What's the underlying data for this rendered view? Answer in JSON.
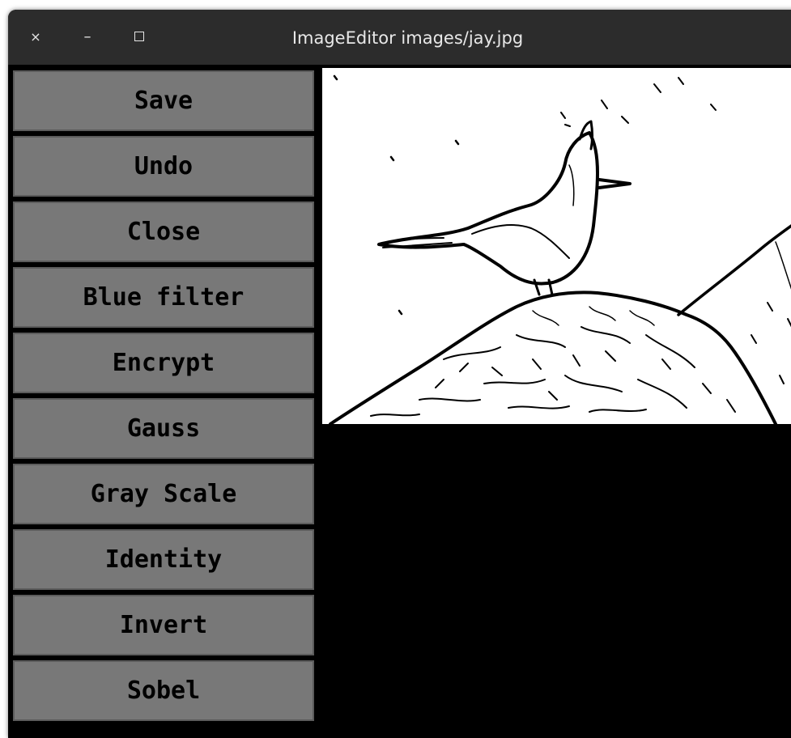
{
  "window": {
    "title": "ImageEditor images/jay.jpg",
    "controls": {
      "close": "×",
      "minimize": "–"
    }
  },
  "sidebar": {
    "buttons": [
      {
        "label": "Save"
      },
      {
        "label": "Undo"
      },
      {
        "label": "Close"
      },
      {
        "label": "Blue filter"
      },
      {
        "label": "Encrypt"
      },
      {
        "label": "Gauss"
      },
      {
        "label": "Gray Scale"
      },
      {
        "label": "Identity"
      },
      {
        "label": "Invert"
      },
      {
        "label": "Sobel"
      }
    ]
  },
  "canvas": {
    "image": "edge-detected jay bird on rock",
    "background_color": "#ffffff",
    "line_color": "#000000"
  },
  "colors": {
    "titlebar": "#2c2c2c",
    "button_bg": "#787878",
    "window_bg": "#000000"
  }
}
